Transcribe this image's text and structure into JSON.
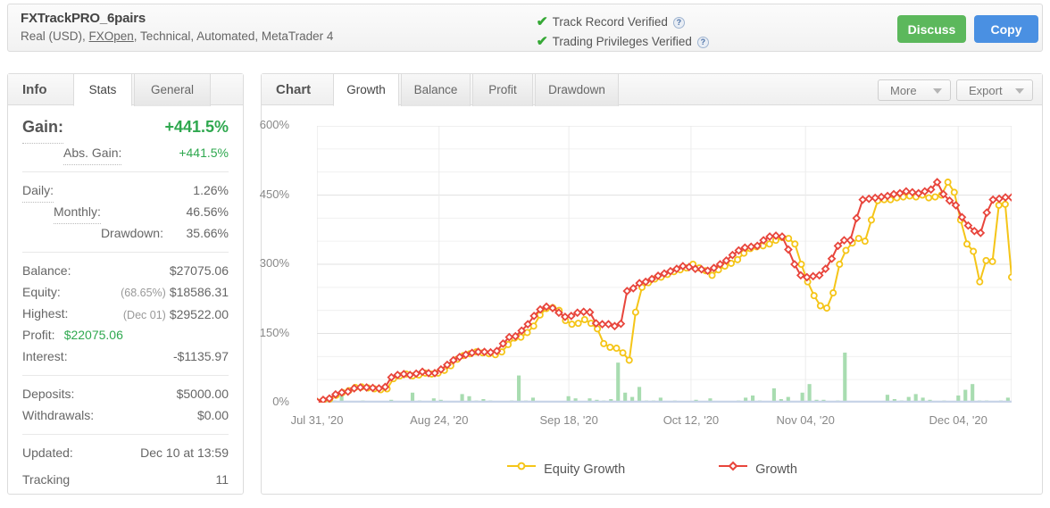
{
  "header": {
    "account_name": "FXTrackPRO_6pairs",
    "account_sub_pre": "Real (USD), ",
    "broker": "FXOpen",
    "account_sub_post": ", Technical, Automated, MetaTrader 4",
    "verify_track_record": "Track Record Verified",
    "verify_trading_privileges": "Trading Privileges Verified",
    "help_glyph": "?",
    "check_glyph": "✔",
    "discuss_label": "Discuss",
    "copy_label": "Copy",
    "discuss_color": "#5cb85c",
    "copy_color": "#4a90e2",
    "verified_color": "#35a835"
  },
  "info_panel": {
    "title": "Info",
    "tabs": [
      {
        "label": "Stats",
        "active": true
      },
      {
        "label": "General",
        "active": false
      }
    ],
    "gain_label": "Gain:",
    "gain_value": "+441.5%",
    "abs_gain_label": "Abs. Gain:",
    "abs_gain_value": "+441.5%",
    "daily_label": "Daily:",
    "daily_value": "1.26%",
    "monthly_label": "Monthly:",
    "monthly_value": "46.56%",
    "drawdown_label": "Drawdown:",
    "drawdown_value": "35.66%",
    "balance_label": "Balance:",
    "balance_value": "$27075.06",
    "equity_label": "Equity:",
    "equity_sub": "(68.65%)",
    "equity_value": "$18586.31",
    "highest_label": "Highest:",
    "highest_sub": "(Dec 01)",
    "highest_value": "$29522.00",
    "profit_label": "Profit:",
    "profit_value": "$22075.06",
    "interest_label": "Interest:",
    "interest_value": "-$1135.97",
    "deposits_label": "Deposits:",
    "deposits_value": "$5000.00",
    "withdrawals_label": "Withdrawals:",
    "withdrawals_value": "$0.00",
    "updated_label": "Updated:",
    "updated_value": "Dec 10 at 13:59",
    "tracking_label": "Tracking",
    "tracking_value": "11",
    "positive_color": "#2fa84f"
  },
  "chart_panel": {
    "title": "Chart",
    "tabs": [
      {
        "label": "Growth",
        "active": true
      },
      {
        "label": "Balance",
        "active": false
      },
      {
        "label": "Profit",
        "active": false
      },
      {
        "label": "Drawdown",
        "active": false
      }
    ],
    "more_label": "More",
    "export_label": "Export"
  },
  "chart_data": {
    "type": "line",
    "title": "Growth",
    "xlabel": "",
    "ylabel": "",
    "ylim": [
      0,
      600
    ],
    "yticks": [
      0,
      150,
      300,
      450,
      600
    ],
    "ytick_labels": [
      "0%",
      "150%",
      "300%",
      "450%",
      "600%"
    ],
    "grid": true,
    "legend_position": "bottom",
    "xtick_labels": [
      "Jul 31, '20",
      "Aug 24, '20",
      "Sep 18, '20",
      "Oct 12, '20",
      "Nov 04, '20",
      "Dec 04, '20"
    ],
    "xtick_indices": [
      0,
      16,
      33,
      49,
      64,
      84
    ],
    "n_points": 92,
    "series": [
      {
        "name": "Growth",
        "color": "#e8453c",
        "marker": "diamond",
        "values": [
          2,
          6,
          9,
          18,
          22,
          24,
          31,
          33,
          33,
          32,
          31,
          34,
          55,
          60,
          62,
          60,
          63,
          67,
          64,
          64,
          72,
          82,
          92,
          99,
          104,
          108,
          110,
          110,
          109,
          112,
          128,
          142,
          144,
          156,
          170,
          188,
          202,
          208,
          205,
          195,
          186,
          188,
          195,
          197,
          196,
          172,
          170,
          170,
          166,
          171,
          242,
          248,
          259,
          262,
          268,
          275,
          280,
          285,
          290,
          296,
          294,
          290,
          289,
          286,
          292,
          300,
          308,
          320,
          330,
          336,
          338,
          340,
          352,
          360,
          362,
          360,
          332,
          300,
          276,
          272,
          274,
          276,
          290,
          312,
          340,
          352,
          352,
          400,
          440,
          442,
          444,
          446,
          448,
          452,
          454,
          458,
          456,
          454,
          458,
          462,
          478,
          452,
          438,
          428,
          402,
          384,
          372,
          368,
          412,
          440,
          442,
          445,
          445
        ]
      },
      {
        "name": "Equity Growth",
        "color": "#f5c518",
        "marker": "circle",
        "values": [
          2,
          5,
          8,
          16,
          22,
          26,
          33,
          34,
          32,
          30,
          28,
          30,
          52,
          58,
          62,
          58,
          60,
          64,
          62,
          64,
          70,
          80,
          94,
          102,
          106,
          110,
          108,
          106,
          104,
          110,
          126,
          140,
          142,
          152,
          166,
          190,
          204,
          206,
          200,
          178,
          170,
          172,
          180,
          172,
          160,
          128,
          120,
          118,
          108,
          92,
          196,
          250,
          260,
          268,
          272,
          278,
          284,
          288,
          292,
          300,
          292,
          286,
          276,
          288,
          296,
          302,
          310,
          324,
          334,
          338,
          340,
          344,
          352,
          358,
          356,
          344,
          300,
          262,
          232,
          210,
          205,
          238,
          300,
          330,
          346,
          356,
          350,
          396,
          438,
          440,
          440,
          444,
          446,
          448,
          446,
          450,
          444,
          446,
          450,
          478,
          456,
          396,
          344,
          328,
          262,
          308,
          306,
          428,
          430,
          272
        ]
      },
      {
        "name": "Deposits Bars",
        "color": "#a8dcb0",
        "type": "bar",
        "values": [
          0,
          2,
          3,
          10,
          2,
          1,
          3,
          2,
          2,
          1,
          4,
          1,
          2,
          14,
          3,
          2,
          6,
          4,
          2,
          2,
          12,
          9,
          3,
          5,
          3,
          2,
          2,
          3,
          38,
          3,
          7,
          2,
          1,
          1,
          2,
          9,
          6,
          2,
          6,
          4,
          3,
          5,
          56,
          14,
          8,
          22,
          3,
          3,
          7,
          1,
          3,
          2,
          2,
          4,
          2,
          6,
          2,
          1,
          1,
          3,
          7,
          10,
          3,
          2,
          20,
          5,
          8,
          2,
          14,
          26,
          4,
          4,
          2,
          3,
          70,
          2,
          1,
          2,
          1,
          1,
          11,
          5,
          3,
          8,
          12,
          7,
          4,
          2,
          3,
          2,
          10,
          18,
          26,
          3,
          3,
          2,
          3,
          7
        ]
      }
    ],
    "legend": [
      {
        "label": "Equity Growth",
        "color": "#f5c518",
        "marker": "circle"
      },
      {
        "label": "Growth",
        "color": "#e8453c",
        "marker": "diamond"
      }
    ]
  }
}
